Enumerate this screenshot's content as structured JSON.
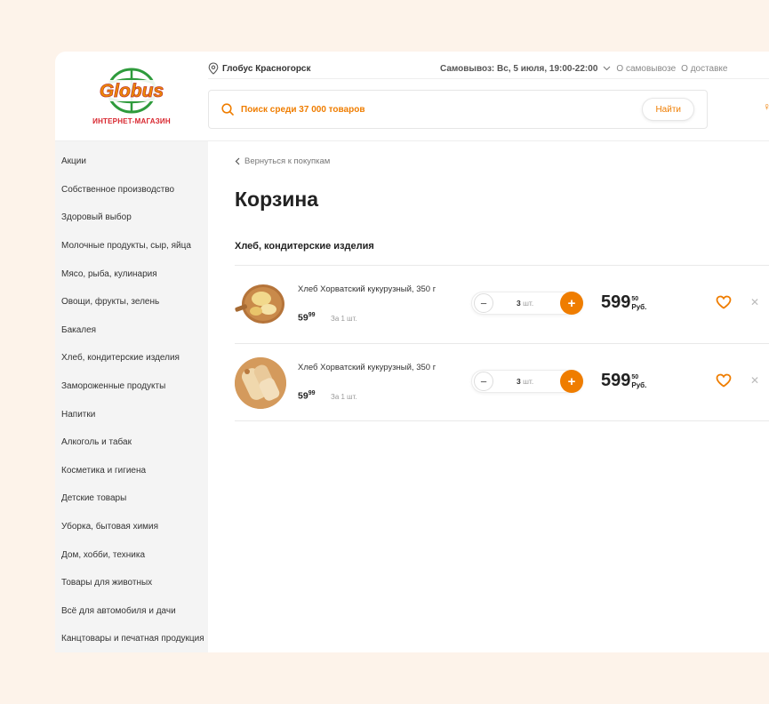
{
  "header": {
    "logo_text": "GLOBUS",
    "logo_sub": "ИНТЕРНЕТ-МАГАЗИН",
    "location": "Глобус Красногорск",
    "pickup": "Самовывоз: Вс, 5 июля, 19:00-22:00",
    "link_pickup": "О самовывозе",
    "link_delivery": "О доставке",
    "search_placeholder": "Поиск среди 37 000 товаров",
    "search_button": "Найти"
  },
  "sidebar": {
    "items": [
      "Акции",
      "Собственное производство",
      "Здоровый выбор",
      "Молочные продукты, сыр, яйца",
      "Мясо, рыба, кулинария",
      "Овощи, фрукты, зелень",
      "Бакалея",
      "Хлеб, кондитерские изделия",
      "Замороженные продукты",
      "Напитки",
      "Алкоголь и табак",
      "Косметика и гигиена",
      "Детские товары",
      "Уборка, бытовая химия",
      "Дом, хобби, техника",
      "Товары для животных",
      "Всё для автомобиля и дачи",
      "Канцтовары и печатная продукция"
    ]
  },
  "main": {
    "back": "Вернуться к покупкам",
    "title": "Корзина",
    "section": "Хлеб, кондитерские изделия",
    "items": [
      {
        "name": "Хлеб Хорватский кукурузный, 350 г",
        "price_main": "59",
        "price_cents": "99",
        "per": "За 1 шт.",
        "qty": "3",
        "qty_unit": "шт.",
        "total_main": "599",
        "total_cents": "50",
        "currency": "Руб."
      },
      {
        "name": "Хлеб Хорватский кукурузный, 350 г",
        "price_main": "59",
        "price_cents": "99",
        "per": "За 1 шт.",
        "qty": "3",
        "qty_unit": "шт.",
        "total_main": "599",
        "total_cents": "50",
        "currency": "Руб."
      }
    ]
  },
  "colors": {
    "accent": "#ef7d00",
    "logo_red": "#d8262e",
    "logo_green": "#2e9b3c",
    "page_bg": "#fdf3ea",
    "sidebar_bg": "#f4f4f4"
  }
}
